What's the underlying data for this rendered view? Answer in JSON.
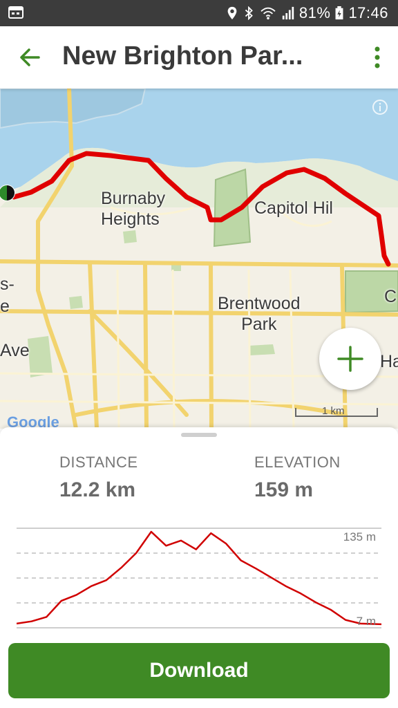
{
  "status_bar": {
    "battery_percent": "81%",
    "time": "17:46",
    "icons": [
      "calendar-icon",
      "location-icon",
      "bluetooth-icon",
      "wifi-icon",
      "signal-icon",
      "battery-icon"
    ]
  },
  "header": {
    "title": "New Brighton Par...",
    "icons": [
      "back-arrow-icon",
      "more-vert-icon"
    ],
    "accent_color": "#3f8a25"
  },
  "map": {
    "labels": {
      "burnaby_heights": "Burnaby\nHeights",
      "capitol_hill": "Capitol Hil",
      "brentwood_park": "Brentwood\nPark",
      "ave": "Ave",
      "s_fragment": "s-",
      "e_fragment": "e",
      "c_fragment": "C",
      "ha_fragment": "Ha"
    },
    "scale_label": "1 km",
    "attribution": "Google",
    "route_color": "#e00000",
    "icons": [
      "info-icon",
      "zoom-in-icon",
      "trailhead-marker-icon"
    ]
  },
  "stats": {
    "distance_label": "DISTANCE",
    "distance_value": "12.2 km",
    "elevation_label": "ELEVATION",
    "elevation_value": "159 m"
  },
  "elevation_chart": {
    "max_label": "135 m",
    "min_label": "7 m",
    "line_color": "#d00000"
  },
  "chart_data": {
    "type": "line",
    "title": "",
    "xlabel": "",
    "ylabel": "",
    "ylim": [
      7,
      135
    ],
    "x": [
      0,
      0.5,
      1,
      1.5,
      2,
      2.5,
      3,
      3.5,
      4,
      4.5,
      5,
      5.5,
      6,
      6.5,
      7,
      7.5,
      8,
      8.5,
      9,
      9.5,
      10,
      10.5,
      11,
      11.5,
      12.2
    ],
    "series": [
      {
        "values": [
          9,
          12,
          18,
          40,
          48,
          60,
          68,
          85,
          105,
          134,
          115,
          122,
          110,
          132,
          118,
          95,
          84,
          72,
          60,
          50,
          38,
          28,
          14,
          9,
          8
        ]
      }
    ]
  },
  "download_button": {
    "label": "Download",
    "color": "#3f8a25"
  }
}
